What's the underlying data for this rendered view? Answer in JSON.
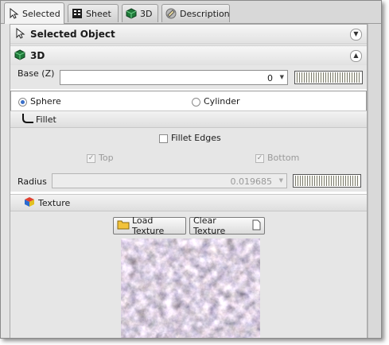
{
  "tabs": [
    {
      "label": "Selected",
      "icon": "cursor-icon"
    },
    {
      "label": "Sheet",
      "icon": "sheet-icon"
    },
    {
      "label": "3D",
      "icon": "cube-icon"
    },
    {
      "label": "Description",
      "icon": "description-icon"
    }
  ],
  "selected_object": {
    "title": "Selected Object",
    "toggle": "chevron-down-icon"
  },
  "three_d": {
    "title": "3D",
    "toggle": "chevron-up-icon",
    "base_label": "Base  (Z)",
    "base_value": "0",
    "shape": {
      "sphere": "Sphere",
      "cylinder": "Cylinder",
      "selected": "Sphere"
    },
    "fillet": {
      "title": "Fillet",
      "edges_label": "Fillet Edges",
      "edges_checked": false,
      "top_label": "Top",
      "top_checked": true,
      "bottom_label": "Bottom",
      "bottom_checked": true,
      "radius_label": "Radius",
      "radius_value": "0.019685"
    },
    "texture": {
      "title": "Texture",
      "load_label": "Load Texture",
      "clear_label": "Clear Texture"
    }
  },
  "colors": {
    "accent": "#3a6fc9",
    "cube_green": "#1f7a3a"
  }
}
